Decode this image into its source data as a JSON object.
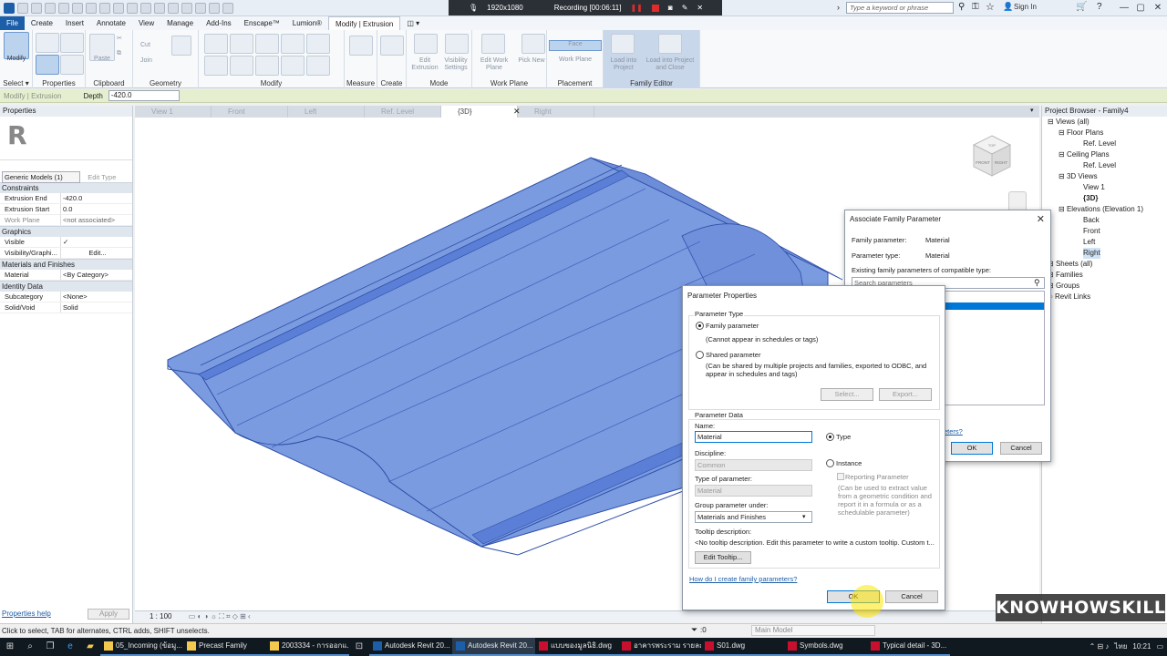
{
  "titlebar": {
    "recording": {
      "resolution": "1920x1080",
      "label": "Recording [00:06:11]"
    },
    "search_placeholder": "Type a keyword or phrase",
    "sign_in": "Sign In",
    "min": "—",
    "max": "▢",
    "close": "✕"
  },
  "ribbon_tabs": [
    "File",
    "Create",
    "Insert",
    "Annotate",
    "View",
    "Manage",
    "Add-Ins",
    "Enscape™",
    "Lumion®",
    "Modify | Extrusion"
  ],
  "ribbon": {
    "groups": {
      "select": "Select ▾",
      "properties": "Properties",
      "clipboard": "Clipboard",
      "geometry": "Geometry",
      "modify": "Modify",
      "measure": "Measure",
      "create": "Create",
      "mode": "Mode",
      "work_plane": "Work Plane",
      "placement": "Placement",
      "family_editor": "Family Editor"
    },
    "buttons": {
      "modify": "Modify",
      "paste": "Paste",
      "cut": "Cut",
      "join": "Join",
      "edit_extrusion": "Edit Extrusion",
      "visibility_settings": "Visibility Settings",
      "edit_work_plane": "Edit Work Plane",
      "pick_new": "Pick New",
      "face": "Face",
      "work_plane": "Work Plane",
      "load_into_project": "Load into Project",
      "load_into_project_close": "Load into Project and Close"
    }
  },
  "optbar": {
    "context": "Modify | Extrusion",
    "depth_label": "Depth",
    "depth_value": "-420.0"
  },
  "properties": {
    "title": "Properties",
    "logo": "R",
    "type": "Generic Models (1)",
    "edit_type": "Edit Type",
    "categories": {
      "constraints": "Constraints",
      "graphics": "Graphics",
      "materials": "Materials and Finishes",
      "identity": "Identity Data"
    },
    "rows": {
      "extrusion_end": {
        "k": "Extrusion End",
        "v": "-420.0"
      },
      "extrusion_start": {
        "k": "Extrusion Start",
        "v": "0.0"
      },
      "work_plane": {
        "k": "Work Plane",
        "v": "<not associated>"
      },
      "visible": {
        "k": "Visible",
        "v": "✓"
      },
      "visibility": {
        "k": "Visibility/Graphi...",
        "v": "Edit..."
      },
      "material": {
        "k": "Material",
        "v": "<By Category>"
      },
      "subcategory": {
        "k": "Subcategory",
        "v": "<None>"
      },
      "solid_void": {
        "k": "Solid/Void",
        "v": "Solid"
      }
    },
    "help": "Properties help",
    "apply": "Apply"
  },
  "view_tabs": [
    "View 1",
    "Front",
    "Left",
    "Ref. Level",
    "{3D}",
    "Right"
  ],
  "viewcube": {
    "front": "FRONT",
    "right": "RIGHT",
    "top": "TOP"
  },
  "view_control": {
    "scale": "1 : 100"
  },
  "project_browser": {
    "title": "Project Browser - Family4",
    "nodes": [
      "Views (all)",
      "Floor Plans",
      "Ref. Level",
      "Ceiling Plans",
      "Ref. Level",
      "3D Views",
      "View 1",
      "{3D}",
      "Elevations (Elevation 1)",
      "Back",
      "Front",
      "Left",
      "Right",
      "Sheets (all)",
      "Families",
      "Groups",
      "Revit Links"
    ]
  },
  "assoc_dialog": {
    "title": "Associate Family Parameter",
    "family_param_label": "Family parameter:",
    "family_param_value": "Material",
    "param_type_label": "Parameter type:",
    "param_type_value": "Material",
    "existing_label": "Existing family parameters of compatible type:",
    "search_placeholder": "Search parameters",
    "link": "eters?",
    "ok": "OK",
    "cancel": "Cancel"
  },
  "param_dialog": {
    "title": "Parameter Properties",
    "param_type_group": "Parameter Type",
    "family_parameter": "Family parameter",
    "family_parameter_note": "(Cannot appear in schedules or tags)",
    "shared_parameter": "Shared parameter",
    "shared_parameter_note1": "(Can be shared by multiple projects and families, exported to ODBC, and",
    "shared_parameter_note2": "appear in schedules and tags)",
    "select": "Select...",
    "export": "Export...",
    "param_data_group": "Parameter Data",
    "name_label": "Name:",
    "name_value": "Material",
    "type_radio": "Type",
    "discipline_label": "Discipline:",
    "discipline_value": "Common",
    "instance_radio": "Instance",
    "reporting": "Reporting Parameter",
    "type_of_param_label": "Type of parameter:",
    "type_of_param_value": "Material",
    "reporting_note": [
      "(Can be used to extract value",
      "from a geometric condition and",
      "report it in a formula or as a",
      "schedulable parameter)"
    ],
    "group_label": "Group parameter under:",
    "group_value": "Materials and Finishes",
    "tooltip_label": "Tooltip description:",
    "tooltip_value": "<No tooltip description. Edit this parameter to write a custom tooltip. Custom t...",
    "edit_tooltip": "Edit Tooltip...",
    "help_link": "How do I create family parameters?",
    "ok": "OK",
    "cancel": "Cancel"
  },
  "statusbar": {
    "message": "Click to select, TAB for alternates, CTRL adds, SHIFT unselects.",
    "zero": ":0",
    "main_model": "Main Model"
  },
  "watermark": "KNOWHOWSKILL",
  "taskbar": {
    "apps": [
      "05_Incoming (ข้อมู...",
      "Precast Family",
      "2003334 - การออกแ...",
      "Autodesk Revit 20...",
      "Autodesk Revit 20...",
      "แบบของมูลนิธิ.dwg",
      "อาคารพระราม รายละ...",
      "S01.dwg",
      "Symbols.dwg",
      "Typical detail - 3D..."
    ],
    "lang": "ไทย",
    "time": "10:21"
  },
  "colors": {
    "accent": "#1c5ea8",
    "model": "#7b9be0",
    "model_edge": "#2d4ea8",
    "family_editor": "#c9d7ea",
    "recording": "#e02b2b"
  }
}
